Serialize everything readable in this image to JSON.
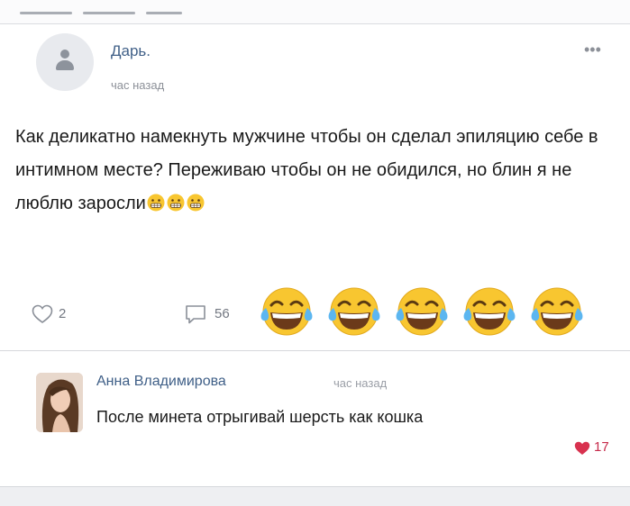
{
  "post": {
    "author": "Дарь.",
    "time": "час назад",
    "more_icon": "more-horizontal-icon",
    "text": "Как деликатно намекнуть мужчине чтобы он сделал эпиляцию себе в интимном месте? Переживаю чтобы он не обидился, но блин я не люблю заросли",
    "inline_emoji": [
      "grimace-emoji",
      "grimace-emoji",
      "grimace-emoji"
    ],
    "likes": "2",
    "comments": "56",
    "reaction_emoji": [
      "tears-of-joy-emoji",
      "tears-of-joy-emoji",
      "tears-of-joy-emoji",
      "tears-of-joy-emoji",
      "tears-of-joy-emoji"
    ]
  },
  "comment": {
    "author": "Анна Владимирова",
    "time": "час назад",
    "text": "После минета отрыгивай шерсть как кошка",
    "likes": "17"
  },
  "colors": {
    "link": "#3f5f87",
    "heart": "#d8324f",
    "emoji_yellow": "#f8c630"
  }
}
